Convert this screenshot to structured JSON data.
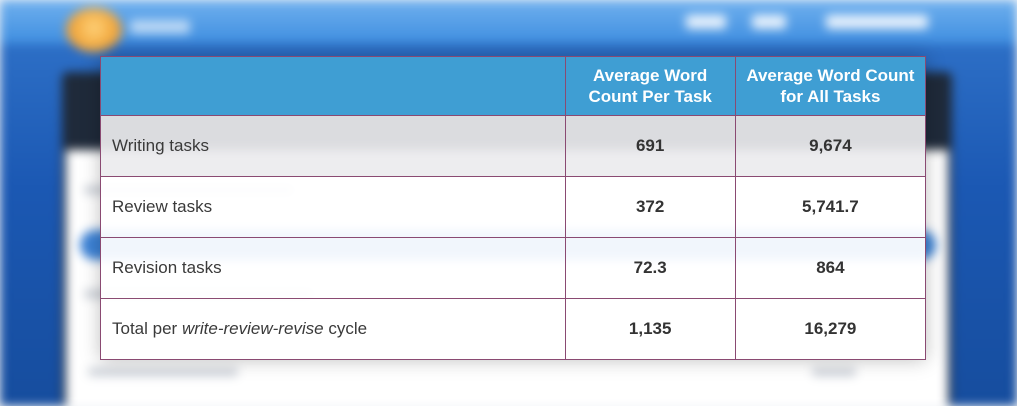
{
  "table": {
    "headers": [
      "",
      "Average Word Count Per Task",
      "Average Word Count for All Tasks"
    ],
    "rows": [
      {
        "label": "Writing tasks",
        "per_task": "691",
        "all_tasks": "9,674"
      },
      {
        "label": "Review tasks",
        "per_task": "372",
        "all_tasks": "5,741.7"
      },
      {
        "label": "Revision tasks",
        "per_task": "72.3",
        "all_tasks": "864"
      }
    ],
    "total_row": {
      "label_prefix": "Total per ",
      "label_emphasis": "write-review-revise",
      "label_suffix": " cycle",
      "per_task": "1,135",
      "all_tasks": "16,279"
    }
  },
  "colors": {
    "header_bg": "#3f9ed3",
    "border": "#8a4a72",
    "background_band": "#1b58b3"
  }
}
